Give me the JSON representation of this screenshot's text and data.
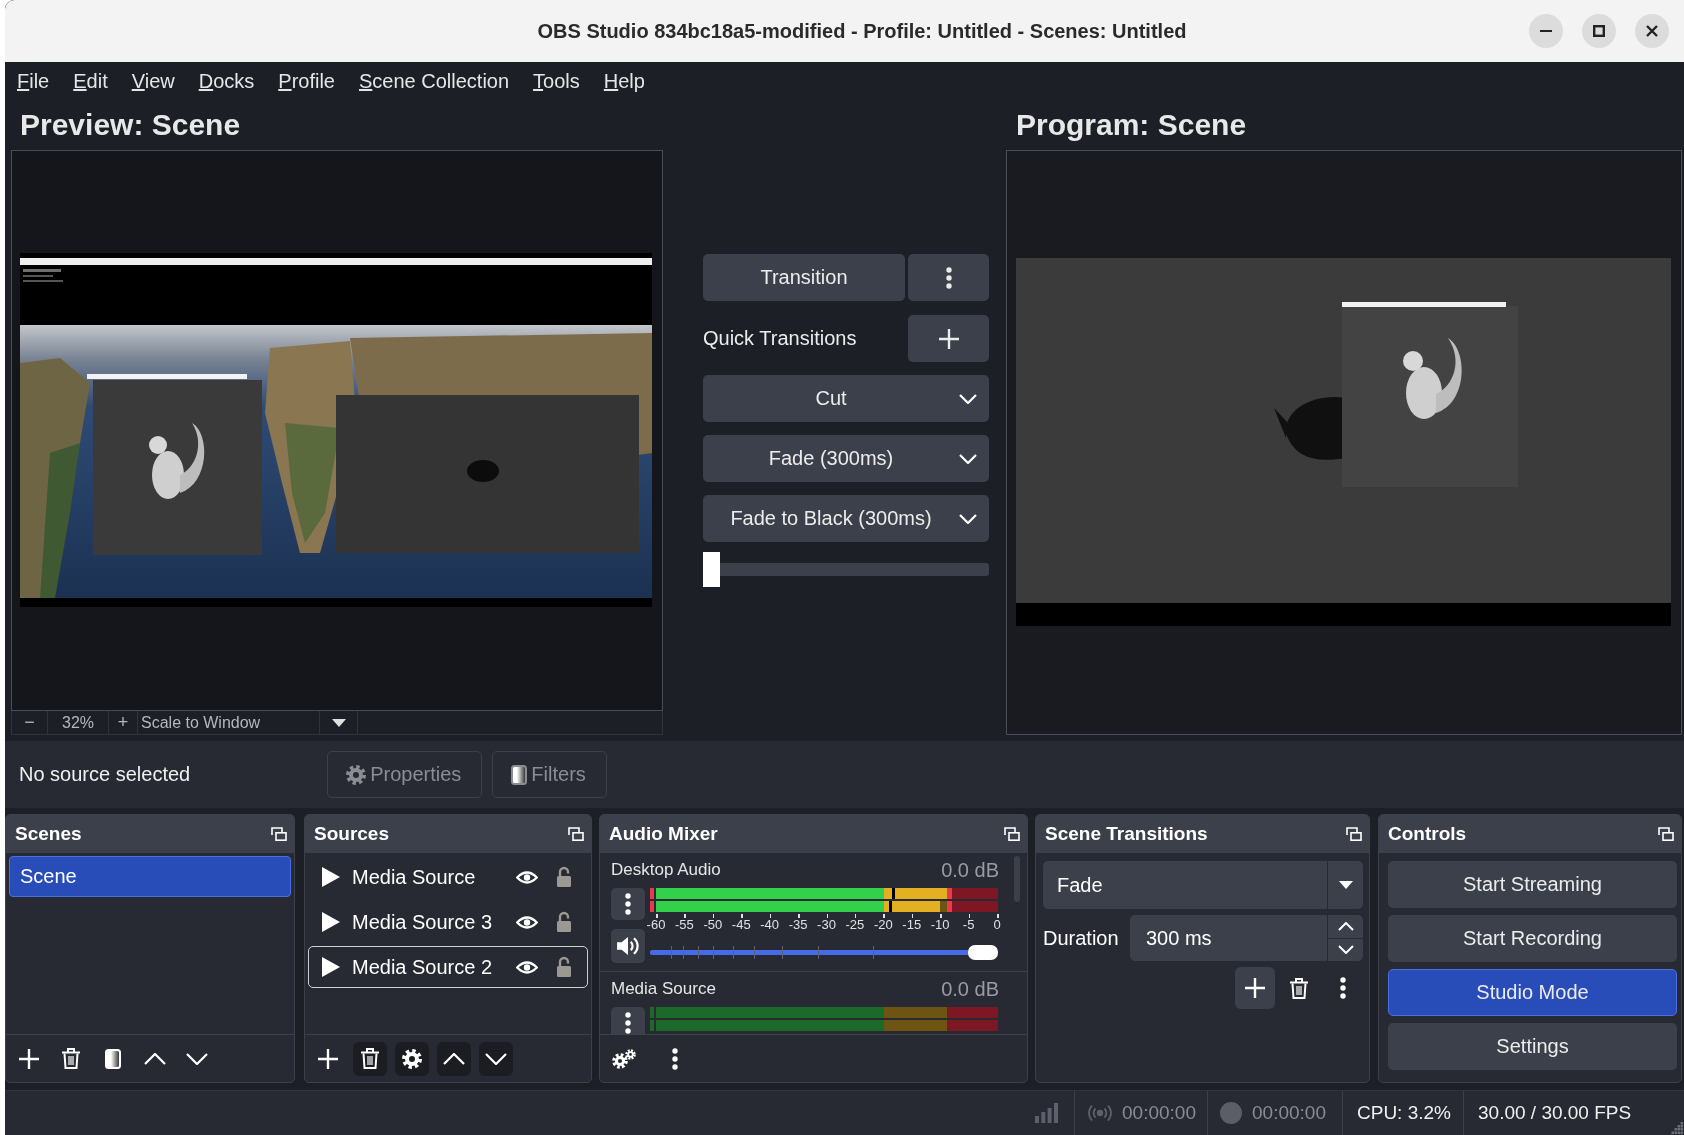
{
  "window": {
    "title": "OBS Studio 834bc18a5-modified - Profile: Untitled - Scenes: Untitled"
  },
  "menu_bar": {
    "items": [
      "File",
      "Edit",
      "View",
      "Docks",
      "Profile",
      "Scene Collection",
      "Tools",
      "Help"
    ]
  },
  "preview": {
    "title": "Preview: Scene",
    "zoom_bar": {
      "zoom_out": "−",
      "zoom": "32%",
      "zoom_in": "+",
      "scale_mode": "Scale to Window"
    }
  },
  "transitions_panel": {
    "transition_button": "Transition",
    "quick_transitions_label": "Quick Transitions",
    "quick_transitions": [
      "Cut",
      "Fade (300ms)",
      "Fade to Black (300ms)"
    ],
    "t_bar": {
      "level": 0
    }
  },
  "program": {
    "title": "Program: Scene"
  },
  "source_toolbar": {
    "status": "No source selected",
    "buttons": [
      {
        "kind": "properties",
        "label": "Properties",
        "disabled": true
      },
      {
        "kind": "filters",
        "label": "Filters",
        "disabled": true
      }
    ]
  },
  "scenes_dock": {
    "title": "Scenes",
    "items": [
      {
        "label": "Scene",
        "selected": true
      }
    ],
    "toolbar": [
      {
        "kind": "add",
        "highlighted": false
      },
      {
        "kind": "remove",
        "highlighted": false
      },
      {
        "kind": "filters",
        "highlighted": false
      },
      {
        "kind": "up",
        "highlighted": false
      },
      {
        "kind": "down",
        "highlighted": false
      }
    ]
  },
  "sources_dock": {
    "title": "Sources",
    "items": [
      {
        "label": "Media Source",
        "visible": true,
        "locked": false,
        "selected": false,
        "focused": false
      },
      {
        "label": "Media Source 3",
        "visible": true,
        "locked": false,
        "selected": false,
        "focused": false
      },
      {
        "label": "Media Source 2",
        "visible": true,
        "locked": false,
        "selected": false,
        "focused": true
      }
    ],
    "toolbar": [
      {
        "kind": "add",
        "highlighted": false
      },
      {
        "kind": "remove",
        "highlighted": true
      },
      {
        "kind": "properties",
        "highlighted": true
      },
      {
        "kind": "up",
        "highlighted": true
      },
      {
        "kind": "down",
        "highlighted": true
      }
    ]
  },
  "audio_mixer": {
    "title": "Audio Mixer",
    "channels": [
      {
        "name": "Desktop Audio",
        "reading": "0.0 dB",
        "meter": [
          {
            "zones": [
              {
                "kind": "normal",
                "level": 1
              },
              {
                "kind": "warning",
                "level": 1
              },
              {
                "kind": "error",
                "level": 0.1
              }
            ],
            "magnitude": {
              "level": 0.69
            }
          },
          {
            "zones": [
              {
                "kind": "normal",
                "level": 1
              },
              {
                "kind": "warning",
                "level": 0.89
              },
              {
                "kind": "error",
                "level": 0.1
              }
            ],
            "magnitude": {
              "level": 0.68
            }
          }
        ],
        "scale": [
          "-60",
          "-55",
          "-50",
          "-45",
          "-40",
          "-35",
          "-30",
          "-25",
          "-20",
          "-15",
          "-10",
          "-5",
          "0"
        ],
        "muted": false,
        "volume": {
          "level": 1
        }
      },
      {
        "name": "Media Source",
        "reading": "0.0 dB",
        "meter": [
          {
            "zones": [
              {
                "kind": "normal"
              },
              {
                "kind": "warning"
              },
              {
                "kind": "error"
              }
            ]
          },
          {
            "zones": [
              {
                "kind": "normal"
              },
              {
                "kind": "warning"
              },
              {
                "kind": "error"
              }
            ]
          }
        ]
      }
    ]
  },
  "scene_transitions_dock": {
    "title": "Scene Transitions",
    "transition": "Fade",
    "duration_label": "Duration",
    "duration": "300 ms",
    "toolbar": [
      {
        "kind": "add",
        "highlighted": true
      },
      {
        "kind": "remove",
        "highlighted": false
      },
      {
        "kind": "menu",
        "highlighted": false
      }
    ]
  },
  "controls_dock": {
    "title": "Controls",
    "buttons": [
      {
        "label": "Start Streaming",
        "checked": false
      },
      {
        "label": "Start Recording",
        "checked": false
      },
      {
        "label": "Studio Mode",
        "checked": true
      },
      {
        "label": "Settings",
        "checked": false
      }
    ]
  },
  "status_bar": {
    "stream": {
      "time": "00:00:00",
      "active": false
    },
    "record": {
      "time": "00:00:00",
      "active": false
    },
    "cpu": "CPU: 3.2%",
    "fps": "30.00 / 30.00 FPS"
  }
}
